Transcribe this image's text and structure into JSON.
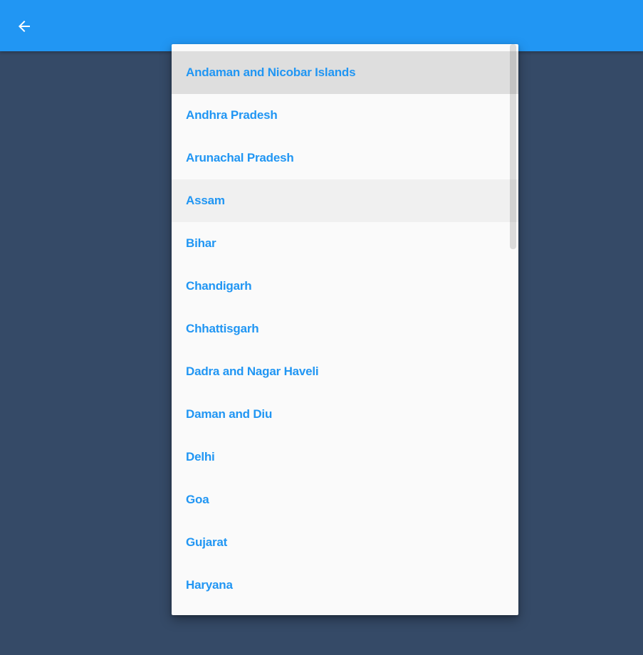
{
  "app_bar": {
    "back_icon": "arrow-back-icon",
    "color": "#2196f3"
  },
  "dropdown": {
    "selected_index": 0,
    "hovered_index": 3,
    "items": [
      {
        "label": "Andaman and Nicobar Islands"
      },
      {
        "label": "Andhra Pradesh"
      },
      {
        "label": "Arunachal Pradesh"
      },
      {
        "label": "Assam"
      },
      {
        "label": "Bihar"
      },
      {
        "label": "Chandigarh"
      },
      {
        "label": "Chhattisgarh"
      },
      {
        "label": "Dadra and Nagar Haveli"
      },
      {
        "label": "Daman and Diu"
      },
      {
        "label": "Delhi"
      },
      {
        "label": "Goa"
      },
      {
        "label": "Gujarat"
      },
      {
        "label": "Haryana"
      }
    ]
  },
  "colors": {
    "background": "#354a67",
    "accent": "#2196f3",
    "menu_background": "#fafafa"
  }
}
